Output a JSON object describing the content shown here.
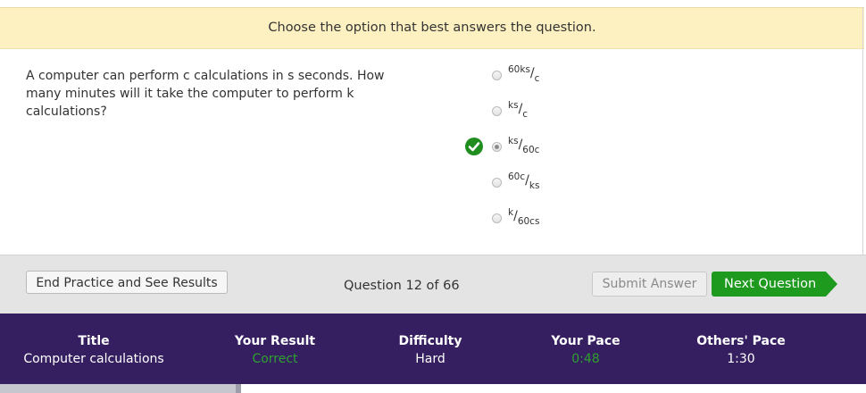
{
  "instruction": "Choose the option that best answers the question.",
  "question": "A computer can perform c calculations in s seconds. How many minutes will it take the computer to perform k calculations?",
  "choices": [
    {
      "num": "60ks",
      "den": "c",
      "selected": false
    },
    {
      "num": "ks",
      "den": "c",
      "selected": false
    },
    {
      "num": "ks",
      "den": "60c",
      "selected": true
    },
    {
      "num": "60c",
      "den": "ks",
      "selected": false
    },
    {
      "num": "k",
      "den": "60cs",
      "selected": false
    }
  ],
  "footer": {
    "end_label": "End Practice and See Results",
    "question_counter": "Question 12 of 66",
    "submit_label": "Submit Answer",
    "next_label": "Next Question"
  },
  "stats": {
    "title_header": "Title",
    "title_value": "Computer calculations",
    "result_header": "Your Result",
    "result_value": "Correct",
    "difficulty_header": "Difficulty",
    "difficulty_value": "Hard",
    "pace_header": "Your Pace",
    "pace_value": "0:48",
    "others_header": "Others' Pace",
    "others_value": "1:30"
  },
  "colors": {
    "banner_bg": "#fdf1c2",
    "stats_bg": "#351f61",
    "success_green": "#1e9a1e"
  }
}
